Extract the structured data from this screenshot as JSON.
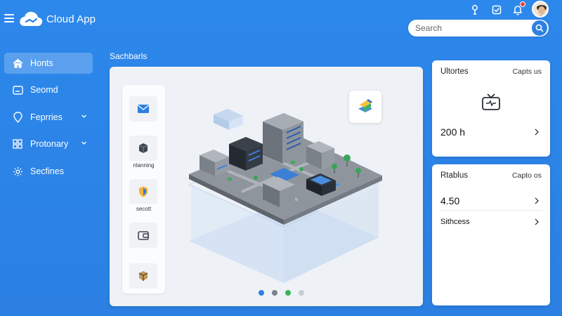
{
  "header": {
    "app_name": "Cloud App",
    "search": {
      "placeholder": "Search",
      "value": ""
    },
    "icons": [
      "bulb-icon",
      "checkbox-icon",
      "bell-icon",
      "avatar"
    ]
  },
  "sidebar": {
    "items": [
      {
        "label": "Honts",
        "icon": "home-icon",
        "active": true,
        "expandable": false
      },
      {
        "label": "Seomd",
        "icon": "card-icon",
        "active": false,
        "expandable": false
      },
      {
        "label": "Feprries",
        "icon": "location-icon",
        "active": false,
        "expandable": true
      },
      {
        "label": "Protonary",
        "icon": "grid-icon",
        "active": false,
        "expandable": true
      },
      {
        "label": "Secfines",
        "icon": "gear-icon",
        "active": false,
        "expandable": false
      }
    ]
  },
  "main": {
    "section_title": "Sachbarls",
    "tools": [
      {
        "icon": "mail-icon",
        "label": ""
      },
      {
        "icon": "box-icon",
        "label": "nlanning"
      },
      {
        "icon": "shield-icon",
        "label": "secott"
      },
      {
        "icon": "wallet-icon",
        "label": ""
      },
      {
        "icon": "package-icon",
        "label": ""
      }
    ],
    "carousel": {
      "pages": 4,
      "active_index": 0,
      "dot_colors": [
        "#2f80e0",
        "#7c8088",
        "#38b55a",
        "#c8ccd2"
      ]
    }
  },
  "cards": [
    {
      "title": "Ultortes",
      "link": "Capts us",
      "icon": "tv-icon",
      "rows": [
        {
          "value": "200 h"
        }
      ]
    },
    {
      "title": "Rtablus",
      "link": "Capto os",
      "rows": [
        {
          "value": "4.50"
        },
        {
          "value": "Sithcess"
        }
      ]
    }
  ],
  "colors": {
    "primary": "#2b84e8",
    "card": "#ffffff",
    "active_item": "rgba(255,255,255,0.22)"
  }
}
